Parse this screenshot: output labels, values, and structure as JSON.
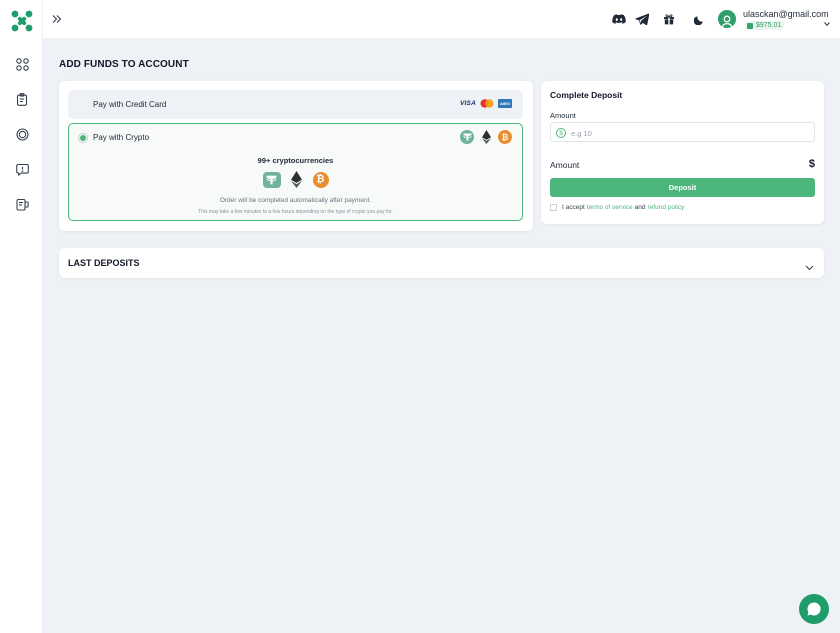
{
  "colors": {
    "accent": "#4cb57c",
    "brand": "#1f9c6c",
    "tether": "#6fb39a",
    "bitcoin": "#e98e2e"
  },
  "sidebar": {
    "logo": "app-logo",
    "items": [
      {
        "icon": "grid-icon"
      },
      {
        "icon": "clipboard-icon"
      },
      {
        "icon": "api-chip-icon"
      },
      {
        "icon": "support-chat-icon"
      },
      {
        "icon": "add-funds-icon"
      }
    ]
  },
  "topbar": {
    "icons": [
      "discord-icon",
      "telegram-icon",
      "gift-icon",
      "moon-icon"
    ],
    "user_email": "ulasckan@gmail.com",
    "balance": "$975.01"
  },
  "page": {
    "title": "ADD FUNDS TO ACCOUNT"
  },
  "payment": {
    "credit_card_label": "Pay with Credit Card",
    "card_logos": [
      "VISA",
      "mastercard",
      "AMEX"
    ],
    "crypto_label": "Pay with Crypto",
    "crypto_selected": true,
    "coins": [
      "tether",
      "ethereum",
      "bitcoin"
    ],
    "crypto_count": "99+ cryptocurrencies",
    "note_primary": "Order will be completed automatically after payment.",
    "note_secondary": "This may take a few minutes to a few hours depending on the type of crypto you pay for."
  },
  "deposit": {
    "title": "Complete Deposit",
    "amount_label": "Amount",
    "amount_placeholder": "e.g 10",
    "currency_symbol": "$",
    "summary_label": "Amount",
    "summary_symbol": "$",
    "button_label": "Deposit",
    "terms_prefix": "I accept",
    "terms_link": "terms of service",
    "terms_and": "and",
    "refund_link": "refund policy"
  },
  "last_deposits": {
    "title": "LAST DEPOSITS"
  }
}
